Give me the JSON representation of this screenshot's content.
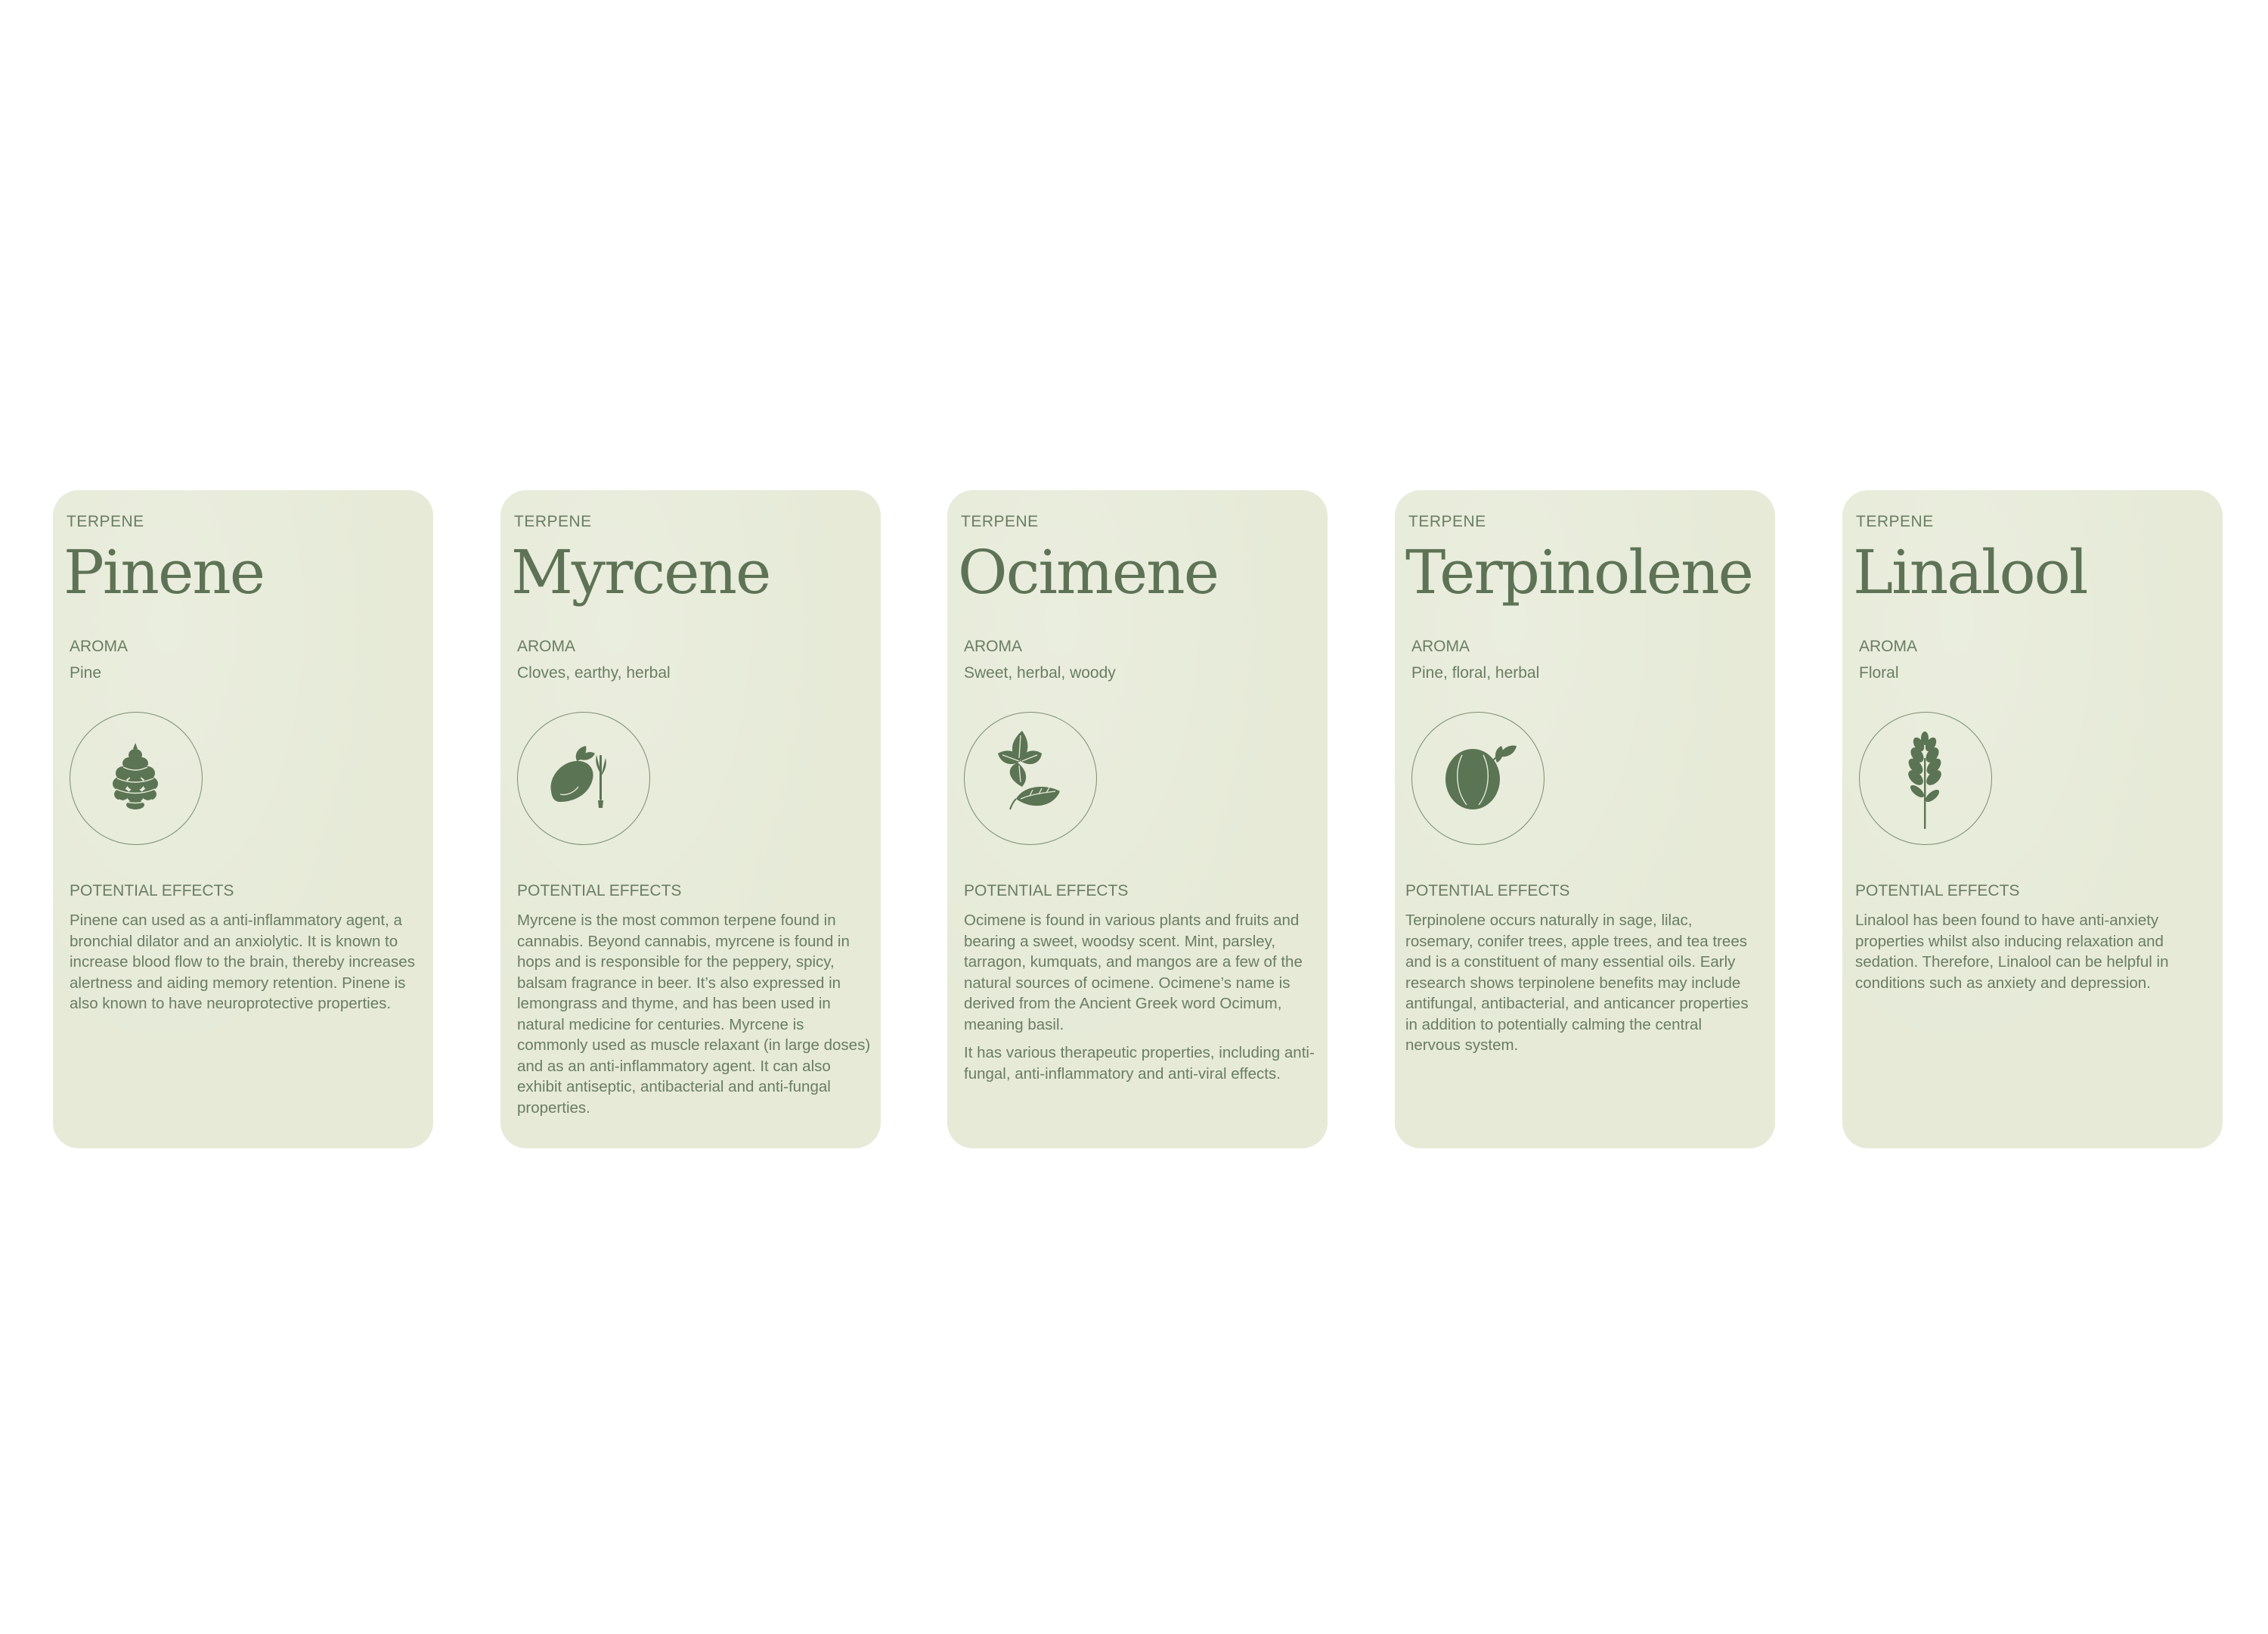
{
  "colors": {
    "card_background": "#e6ead7",
    "text": "#6a7d63",
    "icon_fill": "#5b7454"
  },
  "cards": [
    {
      "eyebrow": "TERPENE",
      "name": "Pinene",
      "aroma_label": "AROMA",
      "aroma": "Pine",
      "icon": "pine-cone-icon",
      "effects_label": "POTENTIAL EFFECTS",
      "effects": [
        "Pinene can used as a anti-inflammatory agent, a bronchial dilator and an anxiolytic. It is known to increase blood flow to the brain, thereby increases alertness and aiding memory retention. Pinene is also known to have neuroprotective properties."
      ]
    },
    {
      "eyebrow": "TERPENE",
      "name": "Myrcene",
      "aroma_label": "AROMA",
      "aroma": "Cloves, earthy, herbal",
      "icon": "mango-lemongrass-icon",
      "effects_label": "POTENTIAL EFFECTS",
      "effects": [
        "Myrcene is the most common terpene found in cannabis. Beyond cannabis, myrcene is found in hops and is responsible for the peppery, spicy, balsam fragrance in beer. It’s also expressed in lemongrass and thyme, and has been used in natural medicine for centuries. Myrcene is commonly used as muscle relaxant (in large doses) and as an anti-inflammatory agent. It can also exhibit antiseptic, antibacterial and anti-fungal properties."
      ]
    },
    {
      "eyebrow": "TERPENE",
      "name": "Ocimene",
      "aroma_label": "AROMA",
      "aroma": "Sweet, herbal, woody",
      "icon": "basil-leaves-icon",
      "effects_label": "POTENTIAL EFFECTS",
      "effects": [
        "Ocimene is found in various plants and fruits and bearing a sweet, woodsy scent. Mint, parsley, tarragon, kumquats, and mangos are a few of the natural sources of ocimene. Ocimene’s name is derived from the Ancient Greek word Ocimum, meaning basil.",
        "It has various therapeutic properties, including anti-fungal, anti-inflammatory and anti-viral effects."
      ]
    },
    {
      "eyebrow": "TERPENE",
      "name": "Terpinolene",
      "aroma_label": "AROMA",
      "aroma": "Pine, floral, herbal",
      "icon": "nutmeg-icon",
      "effects_label": "POTENTIAL EFFECTS",
      "effects": [
        "Terpinolene occurs naturally in sage, lilac, rosemary, conifer trees, apple trees, and tea trees and is a constituent of many essential oils. Early research shows terpinolene benefits may include antifungal, antibacterial, and anticancer properties in addition to potentially calming the central nervous system."
      ]
    },
    {
      "eyebrow": "TERPENE",
      "name": "Linalool",
      "aroma_label": "AROMA",
      "aroma": "Floral",
      "icon": "lavender-sprig-icon",
      "effects_label": "POTENTIAL EFFECTS",
      "effects": [
        "Linalool has been found to have anti-anxiety properties whilst also inducing relaxation and sedation. Therefore, Linalool can be helpful in conditions such as anxiety and depression."
      ]
    }
  ]
}
